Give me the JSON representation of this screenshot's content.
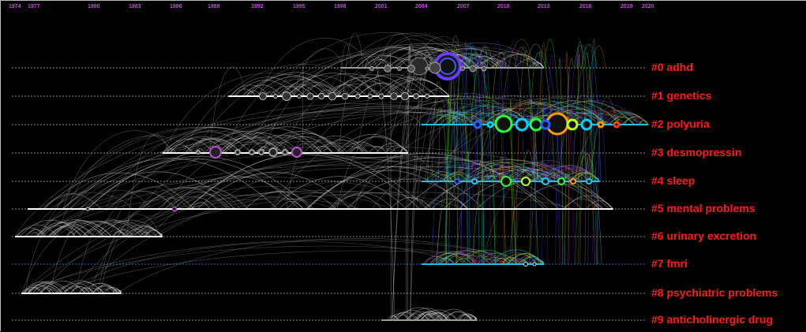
{
  "years": [
    "1974",
    "1977",
    "1980",
    "1983",
    "1986",
    "1989",
    "1992",
    "1995",
    "1998",
    "2001",
    "2004",
    "2007",
    "2010",
    "2013",
    "2016",
    "2019",
    "2020"
  ],
  "clusters": [
    {
      "label": "#0 adhd",
      "color": "#9a9a9a",
      "span": [
        1998,
        2013
      ]
    },
    {
      "label": "#1 genetics",
      "color": "#ffffff",
      "span": [
        1990,
        2006
      ]
    },
    {
      "label": "#2 polyuria",
      "color": "#22c0e0",
      "span": [
        2004,
        2020
      ]
    },
    {
      "label": "#3 desmopressin",
      "color": "#ffffff",
      "span": [
        1985,
        2003
      ]
    },
    {
      "label": "#4 sleep",
      "color": "#22c0e0",
      "span": [
        2004,
        2017
      ]
    },
    {
      "label": "#5 mental problems",
      "color": "#ffffff",
      "span": [
        1976,
        2018
      ]
    },
    {
      "label": "#6 urinary excretion",
      "color": "#ffffff",
      "span": [
        1974,
        1985
      ]
    },
    {
      "label": "#7 fmri",
      "color": "#22c0e0",
      "span": [
        2004,
        2013
      ]
    },
    {
      "label": "#8 psychiatric problems",
      "color": "#ffffff",
      "span": [
        1975,
        1982
      ]
    },
    {
      "label": "#9 anticholinergic drug",
      "color": "#9a9a9a",
      "span": [
        2001,
        2008
      ]
    }
  ]
}
